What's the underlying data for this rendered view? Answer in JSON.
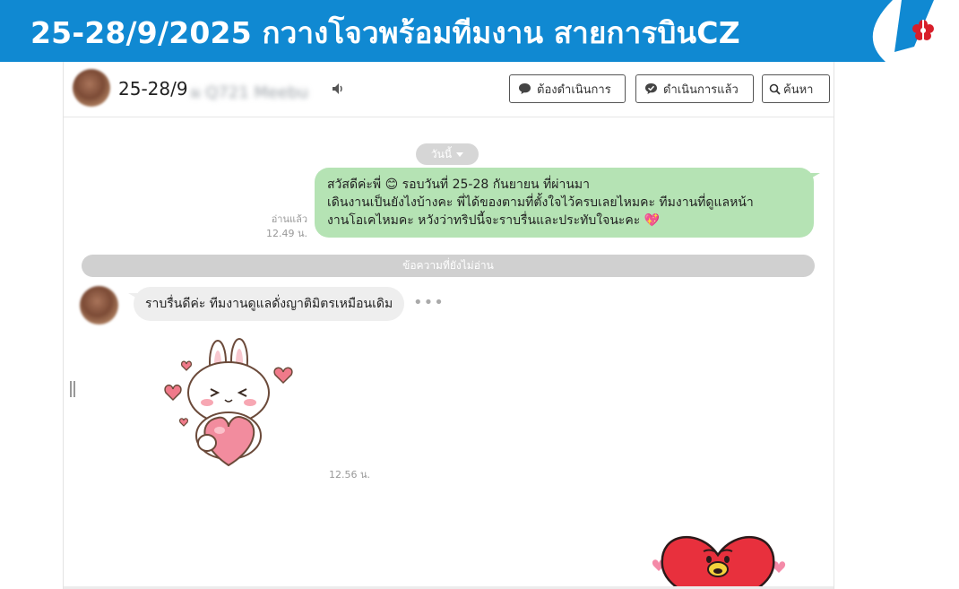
{
  "banner": {
    "title": "25-28/9/2025 กวางโจวพร้อมทีมงาน สายการบินCZ",
    "logo_icon": "kapok-flower-logo",
    "colors": {
      "background": "#1089d2",
      "text": "#ffffff"
    }
  },
  "chat": {
    "title": "25-28/9",
    "title_blurred": "ผ Q721 Meebu",
    "buttons": {
      "todo": "ต้องดำเนินการ",
      "done": "ดำเนินการแล้ว",
      "search": "ค้นหา"
    },
    "date_pill": "วันนี้",
    "outgoing": {
      "lines": [
        "สวัสดีค่ะพี่ 😊 รอบวันที่ 25-28 กันยายน ที่ผ่านมา",
        "เดินงานเป็นยังไงบ้างคะ พี่ได้ของตามที่ตั้งใจไว้ครบเลยไหมคะ ทีมงานที่ดูแลหน้า",
        "งานโอเคไหมคะ หวังว่าทริปนี้จะราบรื่นและประทับใจนะคะ 💖"
      ],
      "read_label": "อ่านแล้ว",
      "time": "12.49 น."
    },
    "unread_divider": "ข้อความที่ยังไม่อ่าน",
    "incoming": {
      "text": "ราบรื่นดีค่ะ ทีมงานดูแลดั่งญาติมิตรเหมือนเดิม",
      "more": "•••",
      "sticker_time": "12.56 น."
    },
    "colors": {
      "outgoing_bubble": "#b5e3b4",
      "incoming_bubble": "#eeeeee",
      "divider": "#d0d0d0"
    }
  }
}
